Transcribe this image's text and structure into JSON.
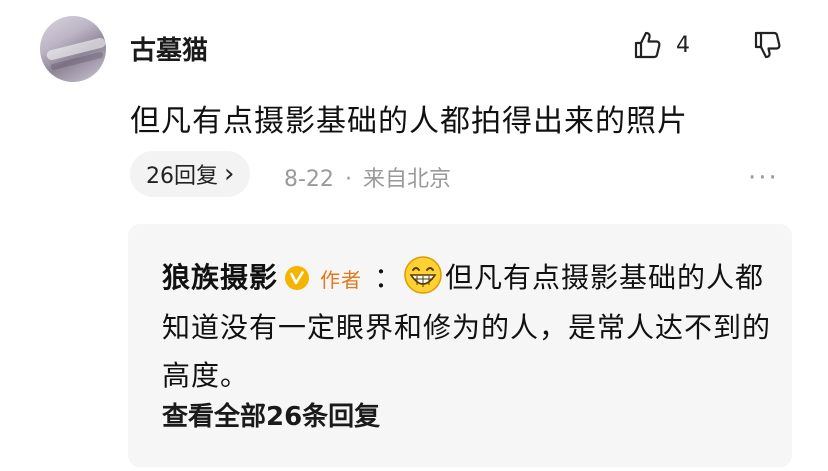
{
  "comment": {
    "username": "古墓猫",
    "like_count": "4",
    "content": "但凡有点摄影基础的人都拍得出来的照片",
    "reply_chip_label": "26回复",
    "chevron": "›",
    "date": "8-22",
    "separator": "·",
    "location": "来自北京",
    "more": "···"
  },
  "reply": {
    "author": "狼族摄影",
    "role_tag": "作者",
    "colon": "：",
    "text": "但凡有点摄影基础的人都知道没有一定眼界和修为的人，是常人达不到的高度。",
    "view_all": "查看全部26条回复"
  },
  "colors": {
    "accent_orange": "#e07a1a",
    "verified_gold": "#f5b400",
    "muted": "#9a9a9a",
    "panel": "#f6f6f6"
  },
  "icons": [
    "thumbs-up-icon",
    "thumbs-down-icon",
    "verified-badge-icon",
    "grinning-emoji-icon",
    "more-icon",
    "chevron-right-icon"
  ]
}
